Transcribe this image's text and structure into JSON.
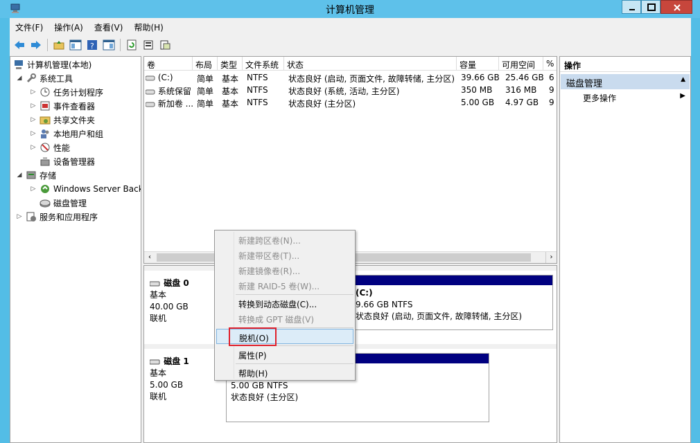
{
  "window": {
    "title": "计算机管理"
  },
  "menu": [
    "文件(F)",
    "操作(A)",
    "查看(V)",
    "帮助(H)"
  ],
  "toolbar": [
    "back-icon",
    "forward-icon",
    "up-folder-icon",
    "show-hide-tree-icon",
    "help-icon",
    "show-hide-action-icon",
    "refresh-icon",
    "properties-icon",
    "export-icon"
  ],
  "tree": {
    "root": "计算机管理(本地)",
    "system_tools": "系统工具",
    "task_scheduler": "任务计划程序",
    "event_viewer": "事件查看器",
    "shared_folders": "共享文件夹",
    "local_users": "本地用户和组",
    "performance": "性能",
    "device_manager": "设备管理器",
    "storage": "存储",
    "wsb": "Windows Server Back",
    "disk_mgmt": "磁盘管理",
    "services": "服务和应用程序"
  },
  "list": {
    "columns": [
      "卷",
      "布局",
      "类型",
      "文件系统",
      "状态",
      "容量",
      "可用空间",
      "%"
    ],
    "rows": [
      [
        "(C:)",
        "简单",
        "基本",
        "NTFS",
        "状态良好 (启动, 页面文件, 故障转储, 主分区)",
        "39.66 GB",
        "25.46 GB",
        "6"
      ],
      [
        "系统保留",
        "简单",
        "基本",
        "NTFS",
        "状态良好 (系统, 活动, 主分区)",
        "350 MB",
        "316 MB",
        "9"
      ],
      [
        "新加卷 ...",
        "简单",
        "基本",
        "NTFS",
        "状态良好 (主分区)",
        "5.00 GB",
        "4.97 GB",
        "9"
      ]
    ]
  },
  "disks": [
    {
      "name": "磁盘 0",
      "type": "基本",
      "size": "40.00 GB",
      "status": "联机",
      "partition": {
        "label": "(C:)",
        "fs": "9.66 GB NTFS",
        "state": "状态良好 (启动, 页面文件, 故障转储, 主分区)"
      }
    },
    {
      "name": "磁盘 1",
      "type": "基本",
      "size": "5.00 GB",
      "status": "联机",
      "partition": {
        "fs": "5.00 GB NTFS",
        "state": "状态良好 (主分区)"
      }
    }
  ],
  "actions": {
    "header": "操作",
    "section": "磁盘管理",
    "more": "更多操作"
  },
  "context_menu": {
    "spanned": "新建跨区卷(N)...",
    "striped": "新建带区卷(T)...",
    "mirrored": "新建镜像卷(R)...",
    "raid5": "新建 RAID-5 卷(W)...",
    "dynamic": "转换到动态磁盘(C)...",
    "gpt": "转换成 GPT 磁盘(V)",
    "offline": "脱机(O)",
    "properties": "属性(P)",
    "help": "帮助(H)"
  },
  "colors": {
    "titlebar": "#5ec1ea",
    "partition_bar": "#000080",
    "highlight": "#e0202b"
  }
}
